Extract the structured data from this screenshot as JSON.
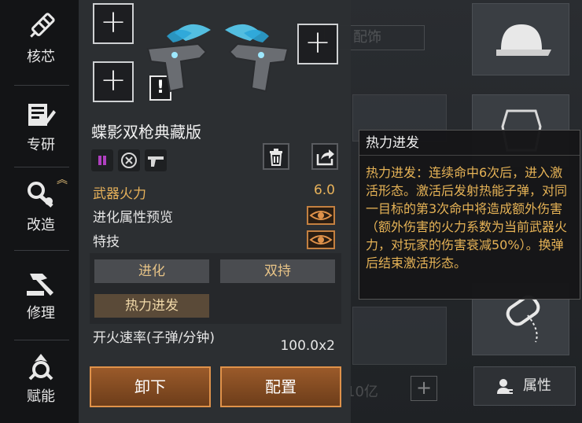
{
  "sidebar": {
    "items": [
      {
        "label": "核芯",
        "icon": "core-icon"
      },
      {
        "label": "专研",
        "icon": "research-icon"
      },
      {
        "label": "改造",
        "icon": "modify-icon"
      },
      {
        "label": "修理",
        "icon": "repair-icon"
      },
      {
        "label": "赋能",
        "icon": "empower-icon"
      }
    ]
  },
  "background": {
    "accessory_label": "配饰",
    "ammo_text": "10亿",
    "plus_label": "+"
  },
  "weapon": {
    "name": "蝶影双枪典藏版",
    "add_slot_label": "+",
    "warn_label": "!"
  },
  "stats": {
    "power_label": "武器火力",
    "power_value": "6.0",
    "preview_label": "进化属性预览",
    "skill_label": "特技",
    "fire_rate_label": "开火速率(子弹/分钟)",
    "fire_rate_value": "100.0x2"
  },
  "skills": {
    "evolve": "进化",
    "dual": "双持",
    "thermal": "热力进发"
  },
  "actions": {
    "unequip": "卸下",
    "configure": "配置"
  },
  "right": {
    "attributes": "属性"
  },
  "tooltip": {
    "title": "热力进发",
    "body": "热力进发：连续命中6次后，进入激活形态。激活后发射热能子弹，对同一目标的第3次命中将造成额外伤害（额外伤害的火力系数为当前武器火力，对玩家的伤害衰减50%）。换弹后结束激活形态。"
  },
  "colors": {
    "accent_orange": "#e0924a",
    "gold_text": "#e6b356",
    "panel_bg": "#2c2f33"
  }
}
